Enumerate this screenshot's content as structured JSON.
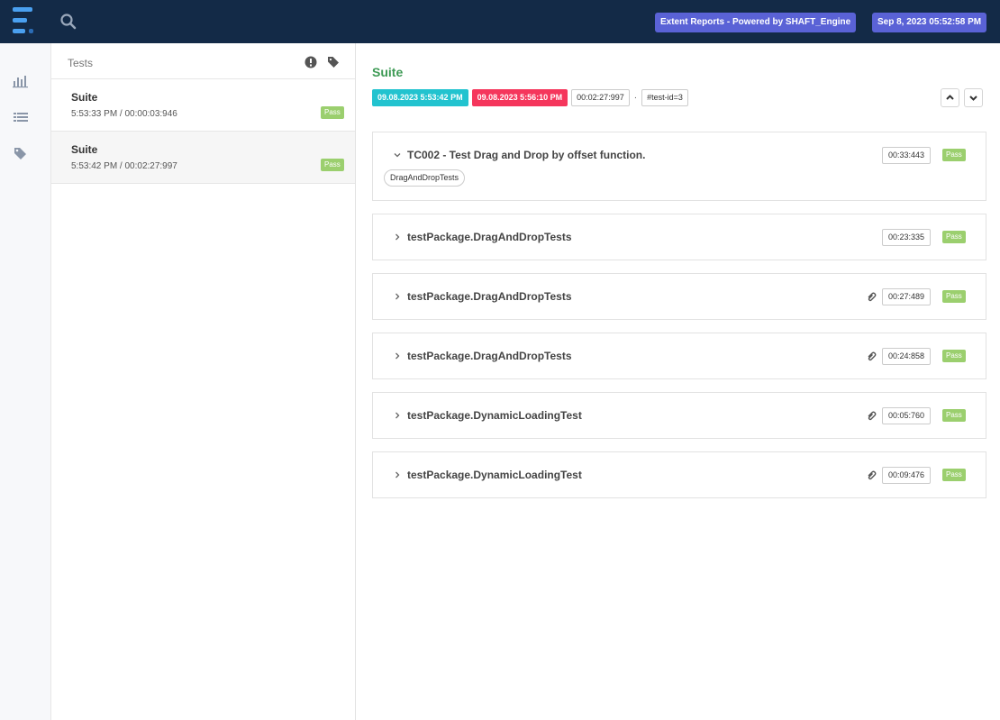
{
  "header": {
    "powered_label": "Extent Reports - Powered by SHAFT_Engine",
    "date_label": "Sep 8, 2023 05:52:58 PM"
  },
  "nav": {
    "icons": [
      "dashboard-chart-icon",
      "list-icon",
      "tag-icon"
    ]
  },
  "test_list": {
    "title": "Tests",
    "items": [
      {
        "name": "Suite",
        "meta": "5:53:33 PM / 00:00:03:946",
        "status": "Pass"
      },
      {
        "name": "Suite",
        "meta": "5:53:42 PM / 00:02:27:997",
        "status": "Pass"
      }
    ]
  },
  "detail": {
    "title": "Suite",
    "start": "09.08.2023 5:53:42 PM",
    "end": "09.08.2023 5:56:10 PM",
    "duration": "00:02:27:997",
    "separator": "·",
    "test_id": "#test-id=3",
    "cards": [
      {
        "name": "TC002 - Test Drag and Drop by offset function.",
        "duration": "00:33:443",
        "status": "Pass",
        "tag": "DragAndDropTests",
        "expanded": true,
        "attachment": false
      },
      {
        "name": "testPackage.DragAndDropTests",
        "duration": "00:23:335",
        "status": "Pass",
        "expanded": false,
        "attachment": false
      },
      {
        "name": "testPackage.DragAndDropTests",
        "duration": "00:27:489",
        "status": "Pass",
        "expanded": false,
        "attachment": true
      },
      {
        "name": "testPackage.DragAndDropTests",
        "duration": "00:24:858",
        "status": "Pass",
        "expanded": false,
        "attachment": true
      },
      {
        "name": "testPackage.DynamicLoadingTest",
        "duration": "00:05:760",
        "status": "Pass",
        "expanded": false,
        "attachment": true
      },
      {
        "name": "testPackage.DynamicLoadingTest",
        "duration": "00:09:476",
        "status": "Pass",
        "expanded": false,
        "attachment": true
      }
    ]
  },
  "colors": {
    "header_bg": "#132a47",
    "pass": "#9bcf6e",
    "start_chip": "#22c3cf",
    "end_chip": "#f5365c",
    "suite_title": "#3d9a54",
    "badge": "#5a62d6"
  }
}
